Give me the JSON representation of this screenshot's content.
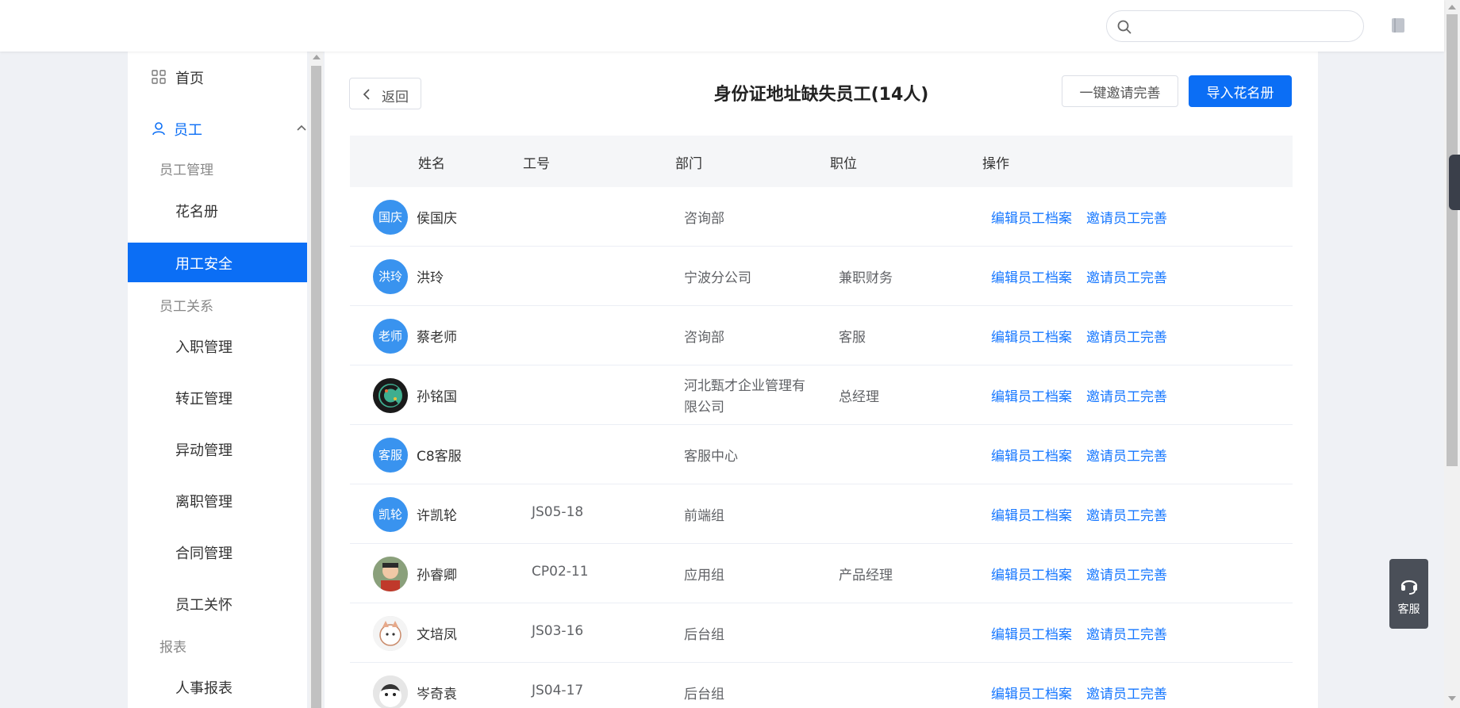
{
  "search": {
    "placeholder": ""
  },
  "sidebar": {
    "home": "首页",
    "employee": "员工",
    "groups": {
      "employee_management": "员工管理",
      "employee_relations": "员工关系",
      "reports": "报表"
    },
    "items": {
      "roster": "花名册",
      "labor_safety": "用工安全",
      "onboarding": "入职管理",
      "regularization": "转正管理",
      "transfer": "异动管理",
      "resignation": "离职管理",
      "contract": "合同管理",
      "care": "员工关怀",
      "hr_report": "人事报表"
    }
  },
  "main": {
    "back_label": "返回",
    "title": "身份证地址缺失员工(14人)",
    "invite_all_label": "一键邀请完善",
    "import_label": "导入花名册",
    "columns": [
      "姓名",
      "工号",
      "部门",
      "职位",
      "操作"
    ],
    "action_edit": "编辑员工档案",
    "action_invite": "邀请员工完善",
    "rows": [
      {
        "avatar": "国庆",
        "name": "侯国庆",
        "id": "",
        "dept": "咨询部",
        "dept2": "",
        "position": ""
      },
      {
        "avatar": "洪玲",
        "name": "洪玲",
        "id": "",
        "dept": "宁波分公司",
        "dept2": "",
        "position": "兼职财务"
      },
      {
        "avatar": "老师",
        "name": "蔡老师",
        "id": "",
        "dept": "咨询部",
        "dept2": "",
        "position": "客服"
      },
      {
        "avatar": "",
        "name": "孙铭国",
        "id": "",
        "dept": "河北甄才企业管理有",
        "dept2": "限公司",
        "position": "总经理"
      },
      {
        "avatar": "客服",
        "name": "C8客服",
        "id": "",
        "dept": "客服中心",
        "dept2": "",
        "position": ""
      },
      {
        "avatar": "凯轮",
        "name": "许凯轮",
        "id": "JS05-18",
        "dept": "前端组",
        "dept2": "",
        "position": ""
      },
      {
        "avatar": "",
        "name": "孙睿卿",
        "id": "CP02-11",
        "dept": "应用组",
        "dept2": "",
        "position": "产品经理"
      },
      {
        "avatar": "",
        "name": "文培凤",
        "id": "JS03-16",
        "dept": "后台组",
        "dept2": "",
        "position": ""
      },
      {
        "avatar": "",
        "name": "岑奇袁",
        "id": "JS04-17",
        "dept": "后台组",
        "dept2": "",
        "position": ""
      }
    ]
  },
  "float": {
    "cs_label": "客服"
  },
  "colors": {
    "primary": "#0b6ef5",
    "link": "#1677ff",
    "avatar_bg": "#3993ef"
  }
}
